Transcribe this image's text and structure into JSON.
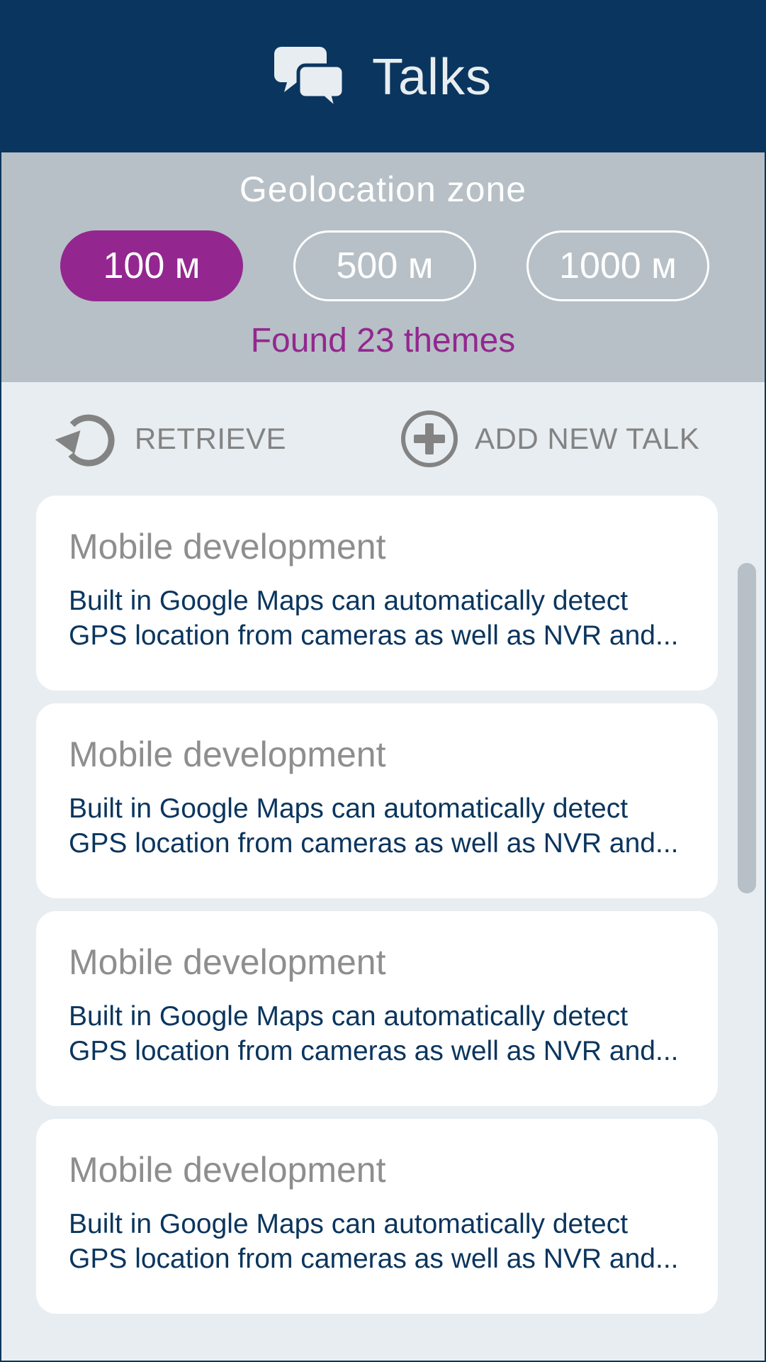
{
  "header": {
    "title": "Talks",
    "icon": "chat-bubbles-icon"
  },
  "geolocation": {
    "label": "Geolocation zone",
    "zones": [
      {
        "label": "100 м",
        "selected": true
      },
      {
        "label": "500 м",
        "selected": false
      },
      {
        "label": "1000 м",
        "selected": false
      }
    ],
    "found_text": "Found 23 themes"
  },
  "actions": {
    "retrieve_label": "RETRIEVE",
    "add_label": "ADD NEW TALK"
  },
  "talks": [
    {
      "title": "Mobile development",
      "line1": "Built in Google Maps can automatically detect",
      "line2": "GPS location from cameras as well as NVR and..."
    },
    {
      "title": "Mobile development",
      "line1": "Built in Google Maps can automatically detect",
      "line2": "GPS location from cameras as well as NVR and..."
    },
    {
      "title": "Mobile development",
      "line1": "Built in Google Maps can automatically detect",
      "line2": "GPS location from cameras as well as NVR and..."
    },
    {
      "title": "Mobile development",
      "line1": "Built in Google Maps can automatically detect",
      "line2": "GPS location from cameras as well as NVR and..."
    }
  ],
  "colors": {
    "header_bg": "#0a355e",
    "panel_bg": "#b7c0c6",
    "accent": "#93278f",
    "page_bg": "#e7edf1",
    "body_text": "#0a355e",
    "muted_text": "#8e8e8e"
  }
}
